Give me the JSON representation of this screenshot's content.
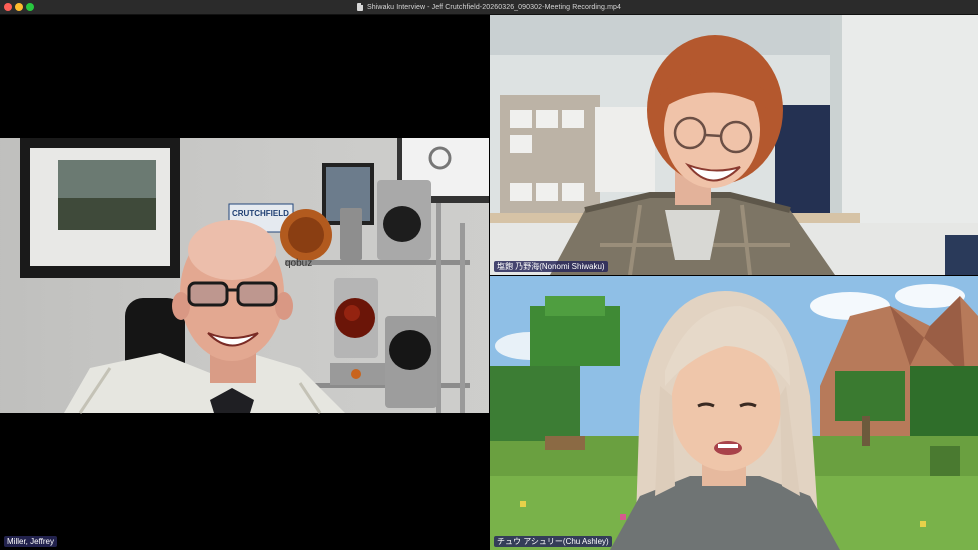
{
  "window": {
    "title": "Shiwaku Interview - Jeff  Crutchfield-20260326_090302-Meeting Recording.mp4"
  },
  "participants": [
    {
      "name": "Miller, Jeffrey"
    },
    {
      "name": "塩飽 乃野海(Nonomi Shiwaku)"
    },
    {
      "name": "チュウ アシュリー(Chu Ashley)"
    }
  ],
  "backdrop": {
    "sign_text": "CRUTCHFIELD",
    "logo_text": "qobuz"
  },
  "colors": {
    "titlebar": "#2b2b2b",
    "nameplate": "#28285a"
  }
}
